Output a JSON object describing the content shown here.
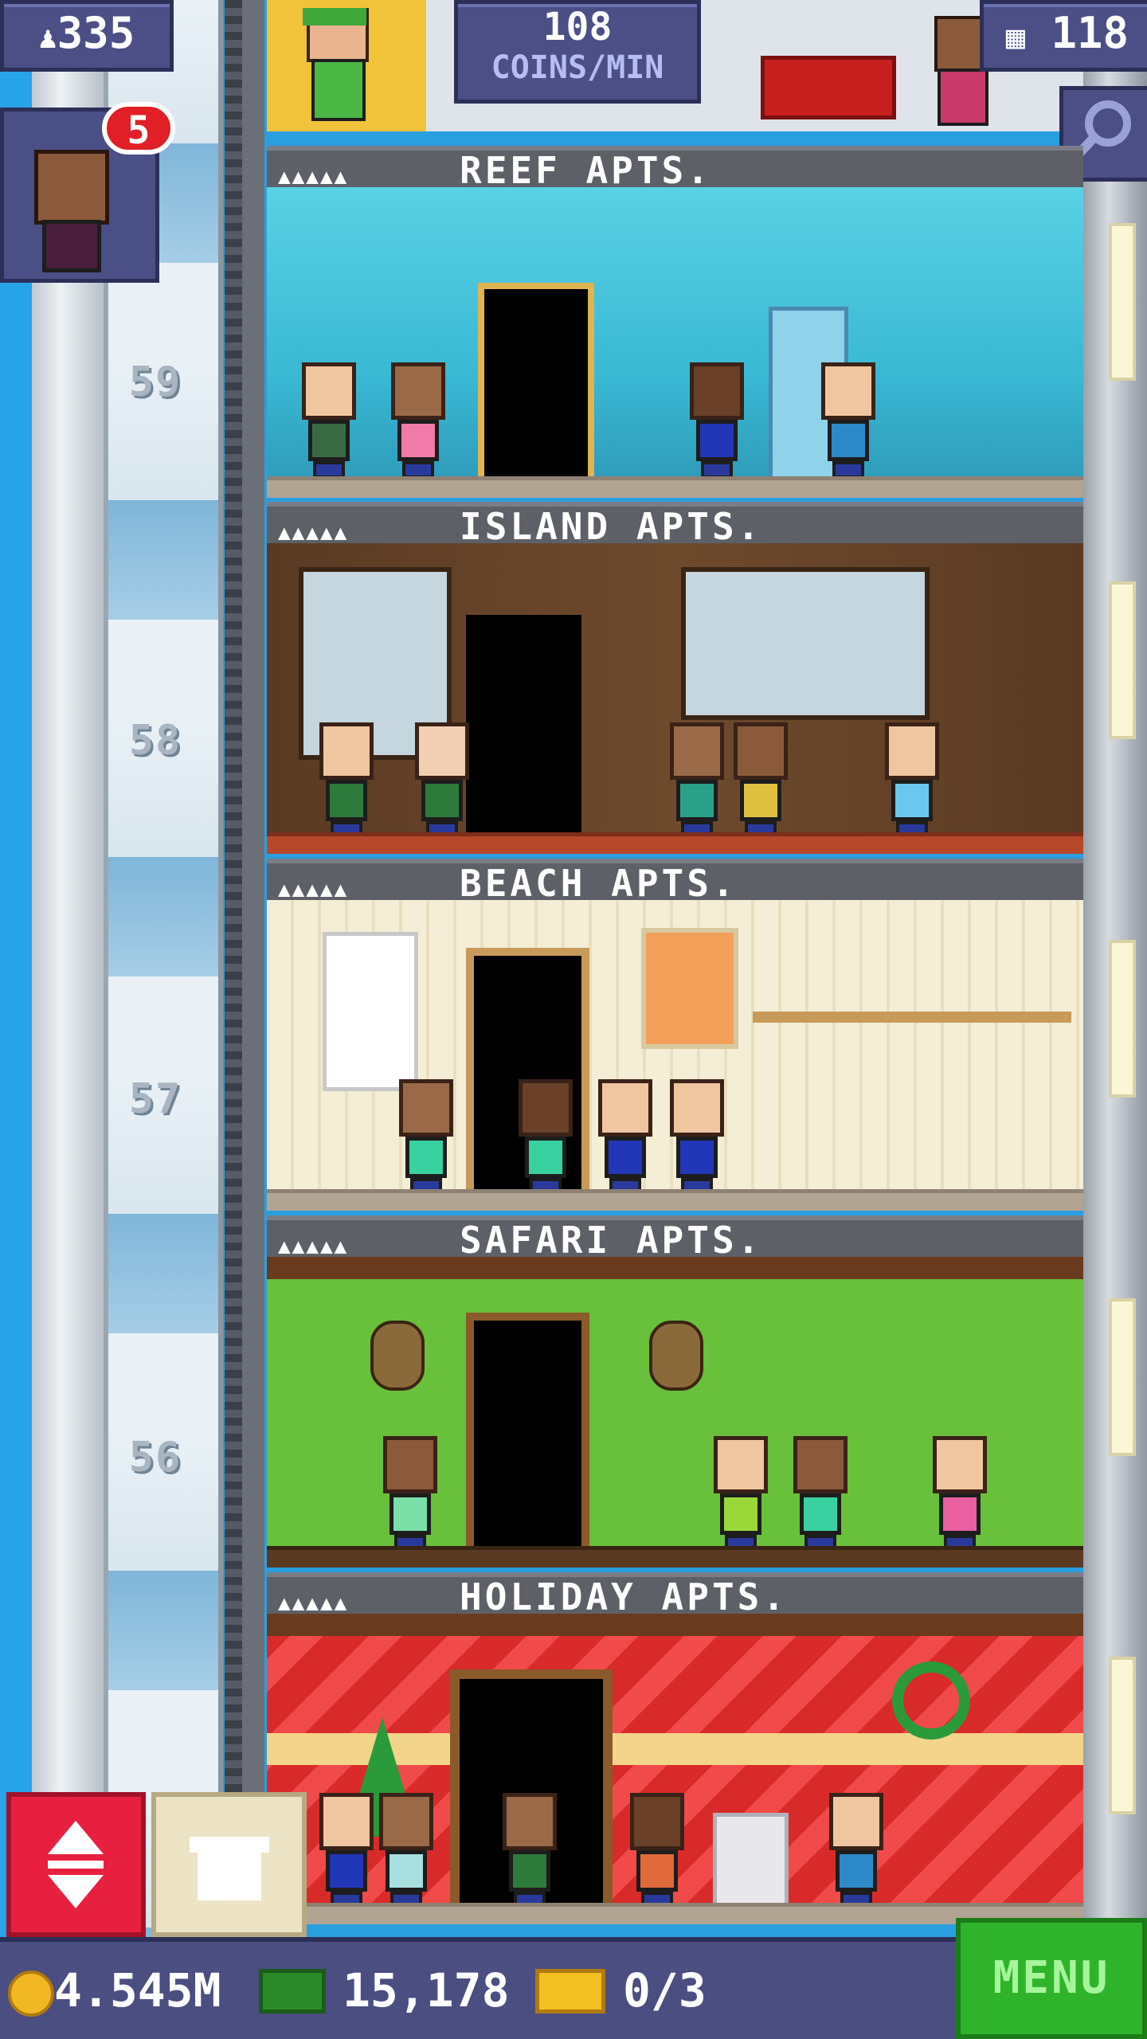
{
  "hud": {
    "population": "335",
    "coins_per_min_value": "108",
    "coins_per_min_unit": "COINS/MIN",
    "floor_count": "118",
    "notification_count": "5"
  },
  "floors": [
    {
      "number": "",
      "name": "REEF APTS.",
      "stars": "▲▲▲▲▲"
    },
    {
      "number": "59",
      "name": "ISLAND APTS.",
      "stars": "▲▲▲▲▲"
    },
    {
      "number": "58",
      "name": "BEACH APTS.",
      "stars": "▲▲▲▲▲"
    },
    {
      "number": "57",
      "name": "SAFARI APTS.",
      "stars": "▲▲▲▲▲"
    },
    {
      "number": "56",
      "name": "HOLIDAY APTS.",
      "stars": "▲▲▲▲▲"
    }
  ],
  "footer": {
    "coins": "4.545M",
    "bux": "15,178",
    "tickets": "0/3",
    "menu_label": "MENU"
  },
  "colors": {
    "reef_wall": "#3ab9d4",
    "island_wall": "#5a3a23",
    "beach_wall": "#f2ecd1",
    "safari_wall": "#69c03a",
    "holiday_wall": "#d92a2a",
    "menu_green": "#2fb32a"
  }
}
